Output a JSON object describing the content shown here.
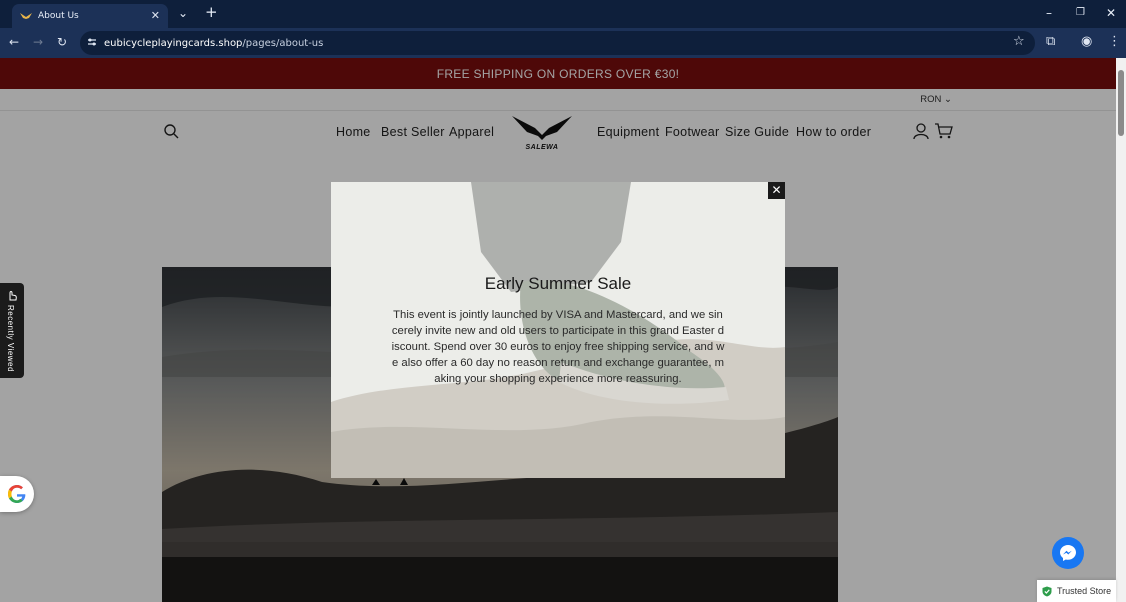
{
  "browser": {
    "tab_title": "About Us",
    "url_host": "eubicycleplayingcards.shop",
    "url_path": "/pages/about-us"
  },
  "site": {
    "announcement": "FREE SHIPPING ON ORDERS OVER €30!",
    "currency": "RON",
    "nav": {
      "home": "Home",
      "best_seller": "Best Seller",
      "apparel": "Apparel",
      "equipment": "Equipment",
      "footwear": "Footwear",
      "size_guide": "Size Guide",
      "how_to_order": "How to order"
    },
    "logo_text": "SALEWA"
  },
  "modal": {
    "title": "Early Summer Sale",
    "body": "This event is jointly launched by VISA and Mastercard, and we sincerely invite new and old users to participate in this grand Easter discount. Spend over 30 euros to enjoy free shipping service, and we also offer a 60 day no reason return and exchange guarantee, making your shopping experience more reassuring."
  },
  "widgets": {
    "recently_viewed": "Recently Viewed",
    "trusted_store": "Trusted Store"
  },
  "colors": {
    "announcement_bg": "#7a0d0d",
    "browser_bg": "#0e1f3b",
    "messenger": "#1877f2"
  }
}
